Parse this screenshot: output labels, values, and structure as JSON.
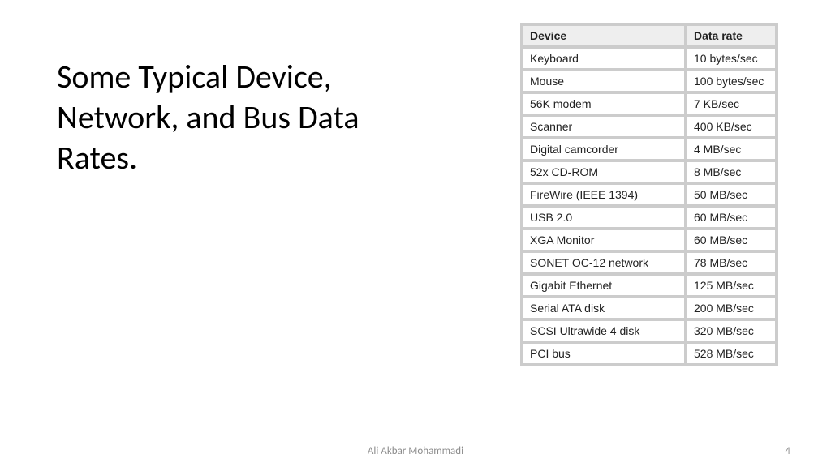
{
  "title": "Some Typical Device, Network, and Bus Data Rates.",
  "table": {
    "headers": {
      "device": "Device",
      "rate": "Data rate"
    },
    "rows": [
      {
        "device": "Keyboard",
        "rate": "10 bytes/sec"
      },
      {
        "device": "Mouse",
        "rate": "100 bytes/sec"
      },
      {
        "device": "56K modem",
        "rate": "7 KB/sec"
      },
      {
        "device": "Scanner",
        "rate": "400 KB/sec"
      },
      {
        "device": "Digital camcorder",
        "rate": "4 MB/sec"
      },
      {
        "device": "52x CD-ROM",
        "rate": "8 MB/sec"
      },
      {
        "device": "FireWire (IEEE 1394)",
        "rate": "50 MB/sec"
      },
      {
        "device": "USB 2.0",
        "rate": "60 MB/sec"
      },
      {
        "device": "XGA Monitor",
        "rate": "60 MB/sec"
      },
      {
        "device": "SONET OC-12 network",
        "rate": "78 MB/sec"
      },
      {
        "device": "Gigabit Ethernet",
        "rate": "125 MB/sec"
      },
      {
        "device": "Serial ATA disk",
        "rate": "200 MB/sec"
      },
      {
        "device": "SCSI Ultrawide 4 disk",
        "rate": "320 MB/sec"
      },
      {
        "device": "PCI bus",
        "rate": "528 MB/sec"
      }
    ]
  },
  "footer": {
    "author": "Ali Akbar Mohammadi",
    "page": "4"
  },
  "chart_data": {
    "type": "table",
    "title": "Some Typical Device, Network, and Bus Data Rates.",
    "columns": [
      "Device",
      "Data rate"
    ],
    "rows": [
      [
        "Keyboard",
        "10 bytes/sec"
      ],
      [
        "Mouse",
        "100 bytes/sec"
      ],
      [
        "56K modem",
        "7 KB/sec"
      ],
      [
        "Scanner",
        "400 KB/sec"
      ],
      [
        "Digital camcorder",
        "4 MB/sec"
      ],
      [
        "52x CD-ROM",
        "8 MB/sec"
      ],
      [
        "FireWire (IEEE 1394)",
        "50 MB/sec"
      ],
      [
        "USB 2.0",
        "60 MB/sec"
      ],
      [
        "XGA Monitor",
        "60 MB/sec"
      ],
      [
        "SONET OC-12 network",
        "78 MB/sec"
      ],
      [
        "Gigabit Ethernet",
        "125 MB/sec"
      ],
      [
        "Serial ATA disk",
        "200 MB/sec"
      ],
      [
        "SCSI Ultrawide 4 disk",
        "320 MB/sec"
      ],
      [
        "PCI bus",
        "528 MB/sec"
      ]
    ]
  }
}
